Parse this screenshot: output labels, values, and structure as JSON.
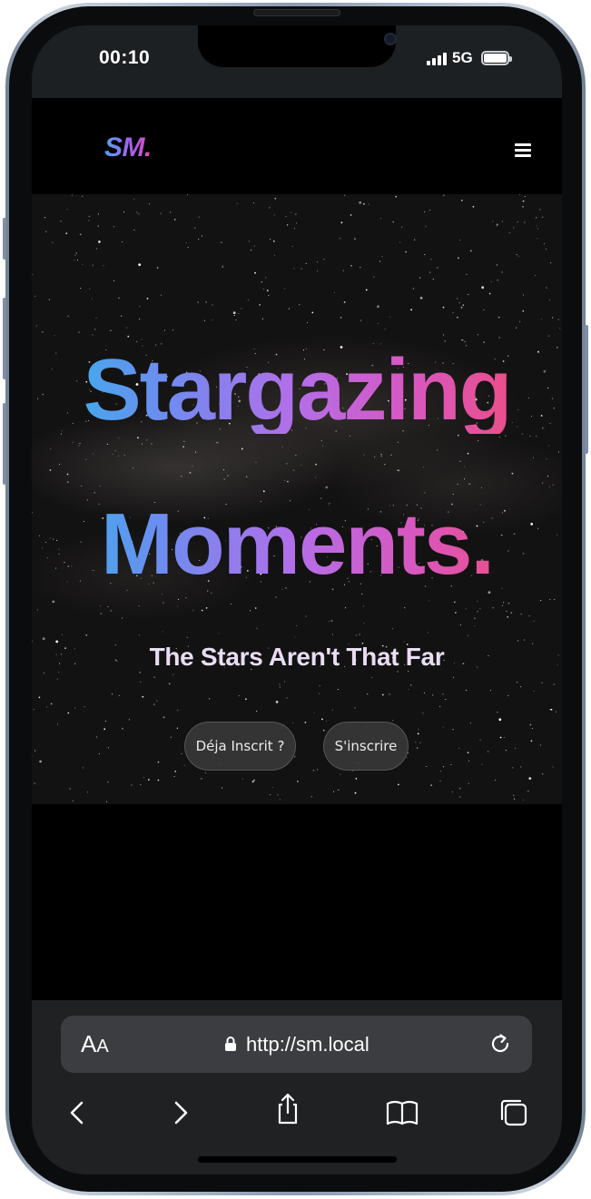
{
  "status_bar": {
    "time": "00:10",
    "network": "5G"
  },
  "navbar": {
    "logo": "SM.",
    "menu_icon": "hamburger-icon"
  },
  "hero": {
    "headline_line1": "Stargazing",
    "headline_line2": "Moments.",
    "tagline": "The Stars Aren't That Far",
    "buttons": {
      "login_label": "Déja Inscrit ?",
      "signup_label": "S'inscrire"
    },
    "gradient_colors": [
      "#2fb7e9",
      "#b46ee9",
      "#f34a6c"
    ]
  },
  "browser": {
    "text_size_big": "A",
    "text_size_small": "A",
    "url": "http://sm.local",
    "icons": {
      "lock": "lock-icon",
      "reload": "reload-icon",
      "back": "chevron-left-icon",
      "forward": "chevron-right-icon",
      "share": "share-icon",
      "bookmarks": "book-icon",
      "tabs": "tabs-icon"
    }
  }
}
